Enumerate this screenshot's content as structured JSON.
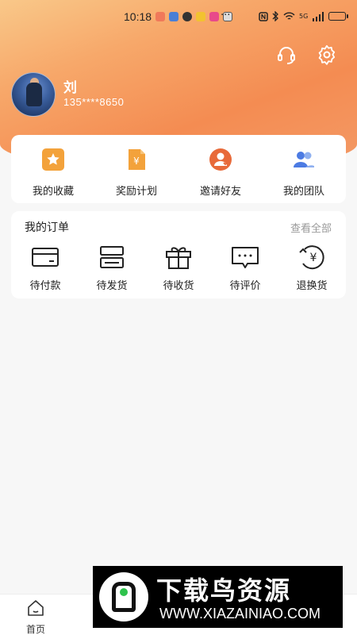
{
  "status_bar": {
    "time": "10:18",
    "more": "···",
    "signal_label": "5G"
  },
  "profile": {
    "name": "刘",
    "phone": "135****8650"
  },
  "top_actions": {
    "customer_service_icon": "headset-icon",
    "settings_icon": "gear-icon"
  },
  "quick_actions": [
    {
      "label": "我的收藏",
      "icon": "star-icon",
      "color": "#f3a23b"
    },
    {
      "label": "奖励计划",
      "icon": "yen-document-icon",
      "color": "#f3a23b"
    },
    {
      "label": "邀请好友",
      "icon": "invite-user-icon",
      "color": "#e86a3a"
    },
    {
      "label": "我的团队",
      "icon": "team-icon",
      "color": "#4c7be3"
    }
  ],
  "orders": {
    "title": "我的订单",
    "view_all": "查看全部",
    "items": [
      {
        "label": "待付款",
        "icon": "wallet-icon"
      },
      {
        "label": "待发货",
        "icon": "box-icon"
      },
      {
        "label": "待收货",
        "icon": "gift-icon"
      },
      {
        "label": "待评价",
        "icon": "comment-icon"
      },
      {
        "label": "退换货",
        "icon": "yen-refund-icon"
      }
    ]
  },
  "tabbar": {
    "tabs": [
      {
        "label": "首页",
        "icon": "home-icon"
      }
    ]
  },
  "watermark": {
    "title": "下载鸟资源",
    "url": "WWW.XIAZAINIAO.COM"
  },
  "colors": {
    "accent": "#f48c52",
    "text": "#222222",
    "muted": "#999999"
  }
}
